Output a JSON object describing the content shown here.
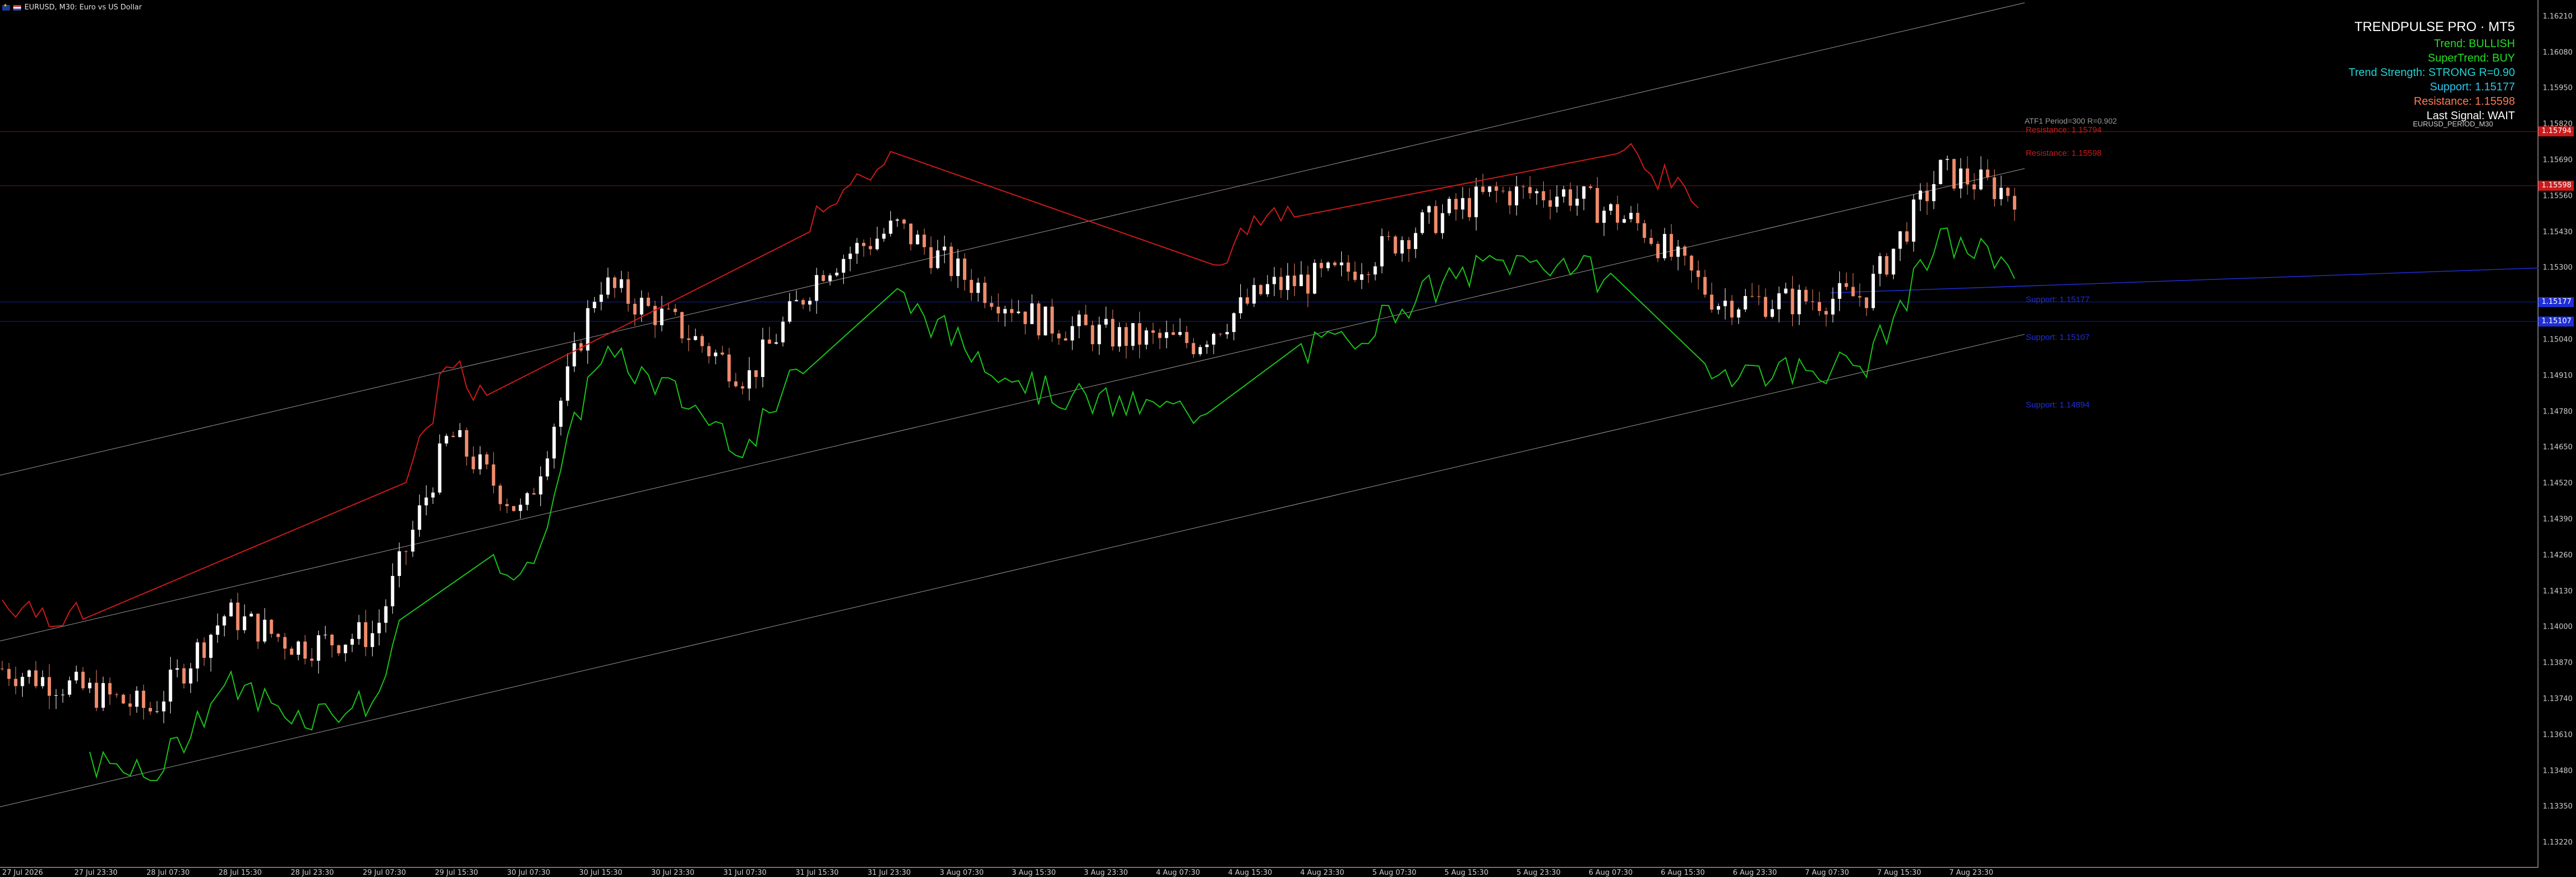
{
  "window": {
    "symbol_text": "EURUSD, M30:  Euro vs US Dollar"
  },
  "panel": {
    "title": "TRENDPULSE PRO  ·  MT5",
    "trend": "Trend: BULLISH",
    "supertrend": "SuperTrend: BUY",
    "strength": "Trend Strength: STRONG  R=0.90",
    "support": "Support: 1.15177",
    "resistance": "Resistance: 1.15598",
    "last_signal": "Last Signal: WAIT"
  },
  "colors": {
    "up_candle": "#ffffff",
    "down_candle": "#f08c6c",
    "supertrend_up": "#19c419",
    "supertrend_down": "#cc1a1a",
    "channel": "#9a9a9a",
    "support": "#1f2fd6",
    "resistance": "#cc1a1a",
    "panel_trend": "#22e022",
    "panel_strength": "#1fd3d3",
    "panel_support": "#2fc7ef",
    "panel_resistance": "#ff7b55",
    "panel_signal": "#ffffff"
  },
  "chart_labels": {
    "channel_info": "ATF1 Period=300 R=0.902",
    "indicator_name": "EURUSD_PERIOD_M30",
    "resistance_1": "Resistance: 1.15794",
    "resistance_2": "Resistance: 1.15598",
    "support_1": "Support: 1.15177",
    "support_2": "Support: 1.15107",
    "support_3": "Support: 1.14894"
  },
  "price_axis": {
    "ticks": [
      "1.16210",
      "1.16080",
      "1.15950",
      "1.15820",
      "1.15690",
      "1.15560",
      "1.15430",
      "1.15300",
      "1.15170",
      "1.15040",
      "1.14910",
      "1.14780",
      "1.14650",
      "1.14520",
      "1.14390",
      "1.14260",
      "1.14130",
      "1.14000",
      "1.13870",
      "1.13740",
      "1.13610",
      "1.13480",
      "1.13350",
      "1.13220"
    ],
    "tags": [
      {
        "text": "1.15794",
        "color": "#cc1a1a",
        "kind": "resistance"
      },
      {
        "text": "1.15598",
        "color": "#cc1a1a",
        "kind": "resistance"
      },
      {
        "text": "1.15177",
        "color": "#1f2fd6",
        "kind": "support"
      },
      {
        "text": "1.15107",
        "color": "#1f2fd6",
        "kind": "support"
      }
    ]
  },
  "time_axis": {
    "labels": [
      "27 Jul 2026",
      "27 Jul 23:30",
      "28 Jul 07:30",
      "28 Jul 15:30",
      "28 Jul 23:30",
      "29 Jul 07:30",
      "29 Jul 15:30",
      "30 Jul 07:30",
      "30 Jul 15:30",
      "30 Jul 23:30",
      "31 Jul 07:30",
      "31 Jul 15:30",
      "31 Jul 23:30",
      "3 Aug 07:30",
      "3 Aug 15:30",
      "3 Aug 23:30",
      "4 Aug 07:30",
      "4 Aug 15:30",
      "4 Aug 23:30",
      "5 Aug 07:30",
      "5 Aug 15:30",
      "5 Aug 23:30",
      "6 Aug 07:30",
      "6 Aug 15:30",
      "6 Aug 23:30",
      "7 Aug 07:30",
      "7 Aug 15:30",
      "7 Aug 23:30"
    ]
  },
  "chart_data": {
    "type": "candlestick",
    "price_range": [
      1.1313,
      1.1627
    ],
    "series": [
      {
        "time": "27 Jul 2026",
        "price": 1.1385
      },
      {
        "time": "27 Jul 23:30",
        "price": 1.1378
      },
      {
        "time": "28 Jul 07:30",
        "price": 1.137
      },
      {
        "time": "28 Jul 15:30",
        "price": 1.1405
      },
      {
        "time": "28 Jul 23:30",
        "price": 1.1393
      },
      {
        "time": "29 Jul 07:30",
        "price": 1.1398
      },
      {
        "time": "29 Jul 15:30",
        "price": 1.147
      },
      {
        "time": "30 Jul 07:30",
        "price": 1.144
      },
      {
        "time": "30 Jul 15:30",
        "price": 1.1525
      },
      {
        "time": "30 Jul 23:30",
        "price": 1.151
      },
      {
        "time": "31 Jul 07:30",
        "price": 1.149
      },
      {
        "time": "31 Jul 15:30",
        "price": 1.153
      },
      {
        "time": "31 Jul 23:30",
        "price": 1.1545
      },
      {
        "time": "3 Aug 07:30",
        "price": 1.1525
      },
      {
        "time": "3 Aug 15:30",
        "price": 1.151
      },
      {
        "time": "3 Aug 23:30",
        "price": 1.1505
      },
      {
        "time": "4 Aug 07:30",
        "price": 1.1503
      },
      {
        "time": "4 Aug 15:30",
        "price": 1.1523
      },
      {
        "time": "4 Aug 23:30",
        "price": 1.1528
      },
      {
        "time": "5 Aug 07:30",
        "price": 1.1545
      },
      {
        "time": "5 Aug 15:30",
        "price": 1.1557
      },
      {
        "time": "5 Aug 23:30",
        "price": 1.1557
      },
      {
        "time": "6 Aug 07:30",
        "price": 1.1545
      },
      {
        "time": "6 Aug 15:30",
        "price": 1.1518
      },
      {
        "time": "6 Aug 23:30",
        "price": 1.1518
      },
      {
        "time": "7 Aug 07:30",
        "price": 1.152
      },
      {
        "time": "7 Aug 15:30",
        "price": 1.1565
      },
      {
        "time": "7 Aug 23:30",
        "price": 1.1557
      }
    ]
  }
}
